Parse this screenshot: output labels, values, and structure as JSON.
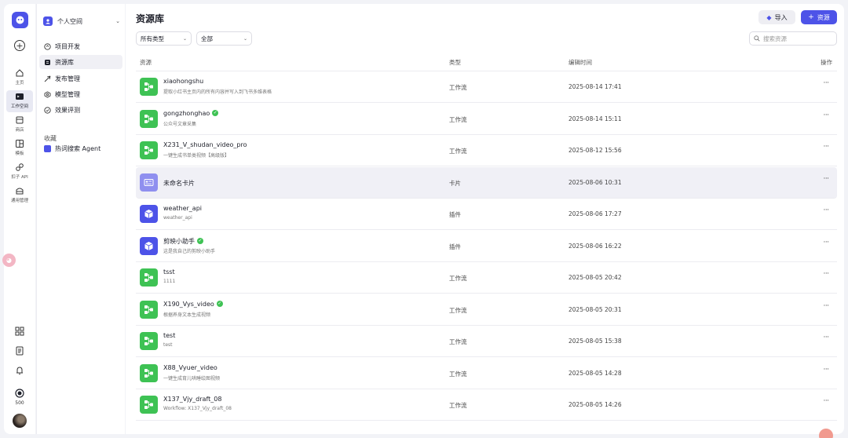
{
  "rail": {
    "items": [
      {
        "label": "主页",
        "icon": "home-icon"
      },
      {
        "label": "工作空间",
        "icon": "workspace-icon"
      },
      {
        "label": "商店",
        "icon": "store-icon"
      },
      {
        "label": "模板",
        "icon": "template-icon"
      },
      {
        "label": "扣子 API",
        "icon": "api-icon"
      },
      {
        "label": "通用管理",
        "icon": "admin-icon"
      }
    ],
    "credits": "500"
  },
  "sidebar": {
    "space_name": "个人空间",
    "nav": [
      {
        "label": "项目开发",
        "icon": "project-icon"
      },
      {
        "label": "资源库",
        "icon": "library-icon"
      },
      {
        "label": "发布管理",
        "icon": "publish-icon"
      },
      {
        "label": "模型管理",
        "icon": "model-icon"
      },
      {
        "label": "效果评测",
        "icon": "evaluation-icon"
      }
    ],
    "favorites_title": "收藏",
    "favorites": [
      {
        "label": "热词搜索 Agent",
        "icon": "agent-icon"
      }
    ]
  },
  "main": {
    "title": "资源库",
    "import_label": "导入",
    "add_label": "资源",
    "filter_type": "所有类型",
    "filter_scope": "全部",
    "search_placeholder": "搜索资源",
    "columns": {
      "resource": "资源",
      "type": "类型",
      "time": "编辑时间",
      "actions": "操作"
    },
    "rows": [
      {
        "name": "xiaohongshu",
        "desc": "提取小红书主页内的所有内容并写入到飞书多维表格",
        "type": "工作流",
        "time": "2025-08-14 17:41",
        "kind": "workflow",
        "verified": false
      },
      {
        "name": "gongzhonghao",
        "desc": "公众号文章采集",
        "type": "工作流",
        "time": "2025-08-14 15:11",
        "kind": "workflow",
        "verified": true
      },
      {
        "name": "X231_V_shudan_video_pro",
        "desc": "一键生成书单类视频【高级版】",
        "type": "工作流",
        "time": "2025-08-12 15:56",
        "kind": "workflow",
        "verified": false
      },
      {
        "name": "未命名卡片",
        "desc": "",
        "type": "卡片",
        "time": "2025-08-06 10:31",
        "kind": "card",
        "verified": false
      },
      {
        "name": "weather_api",
        "desc": "weather_api",
        "type": "插件",
        "time": "2025-08-06 17:27",
        "kind": "plugin",
        "verified": false
      },
      {
        "name": "剪映小助手",
        "desc": "这是我自己的剪映小助手",
        "type": "插件",
        "time": "2025-08-06 16:22",
        "kind": "plugin",
        "verified": true
      },
      {
        "name": "tsst",
        "desc": "1111",
        "type": "工作流",
        "time": "2025-08-05 20:42",
        "kind": "workflow",
        "verified": false
      },
      {
        "name": "X190_Vys_video",
        "desc": "根据养身文本生成视频",
        "type": "工作流",
        "time": "2025-08-05 20:31",
        "kind": "workflow",
        "verified": true
      },
      {
        "name": "test",
        "desc": "test",
        "type": "工作流",
        "time": "2025-08-05 15:38",
        "kind": "workflow",
        "verified": false
      },
      {
        "name": "X88_Vyuer_video",
        "desc": "一键生成育儿哄睡绘图视频",
        "type": "工作流",
        "time": "2025-08-05 14:28",
        "kind": "workflow",
        "verified": false
      },
      {
        "name": "X137_Vjy_draft_08",
        "desc": "Workflow: X137_Vjy_draft_08",
        "type": "工作流",
        "time": "2025-08-05 14:26",
        "kind": "workflow",
        "verified": false
      }
    ]
  },
  "colors": {
    "accent": "#4d53e8",
    "workflow": "#3ec254",
    "card": "#8f8fef",
    "plugin": "#4d53e8"
  }
}
